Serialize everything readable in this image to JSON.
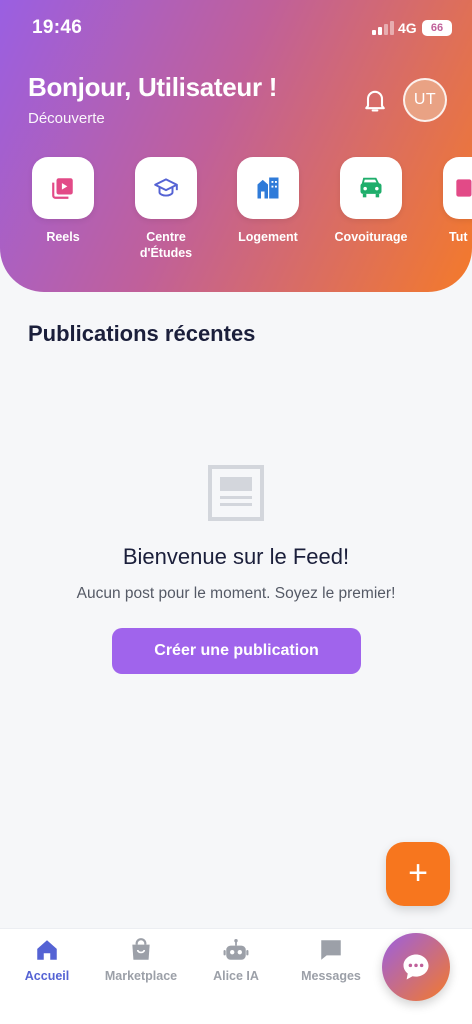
{
  "status_bar": {
    "time": "19:46",
    "network": "4G",
    "battery": "66"
  },
  "header": {
    "greeting": "Bonjour, Utilisateur !",
    "subtitle": "Découverte",
    "avatar_initials": "UT",
    "gradient_start": "#9a5fe2",
    "gradient_end": "#f47a2a"
  },
  "shortcuts": [
    {
      "label": "Reels",
      "icon": "play-video-icon",
      "color": "#e24a87"
    },
    {
      "label": "Centre d'Études",
      "icon": "graduation-cap-icon",
      "color": "#5563d4"
    },
    {
      "label": "Logement",
      "icon": "buildings-icon",
      "color": "#2f7bd9"
    },
    {
      "label": "Covoiturage",
      "icon": "car-icon",
      "color": "#1fae6b"
    },
    {
      "label": "Tut",
      "icon": "book-icon",
      "color": "#e24a87"
    }
  ],
  "feed": {
    "section_title": "Publications récentes",
    "empty_icon": "newspaper-icon",
    "empty_title": "Bienvenue sur le Feed!",
    "empty_text": "Aucun post pour le moment. Soyez le premier!",
    "create_button": "Créer une publication"
  },
  "fab": {
    "label": "+",
    "color": "#f7761e"
  },
  "bottom_nav": [
    {
      "label": "Accueil",
      "icon": "home-icon",
      "active": true
    },
    {
      "label": "Marketplace",
      "icon": "shopping-bag-icon",
      "active": false
    },
    {
      "label": "Alice IA",
      "icon": "robot-icon",
      "active": false
    },
    {
      "label": "Messages",
      "icon": "message-icon",
      "active": false
    }
  ],
  "chat_fab": {
    "icon": "chat-bubble-icon"
  }
}
